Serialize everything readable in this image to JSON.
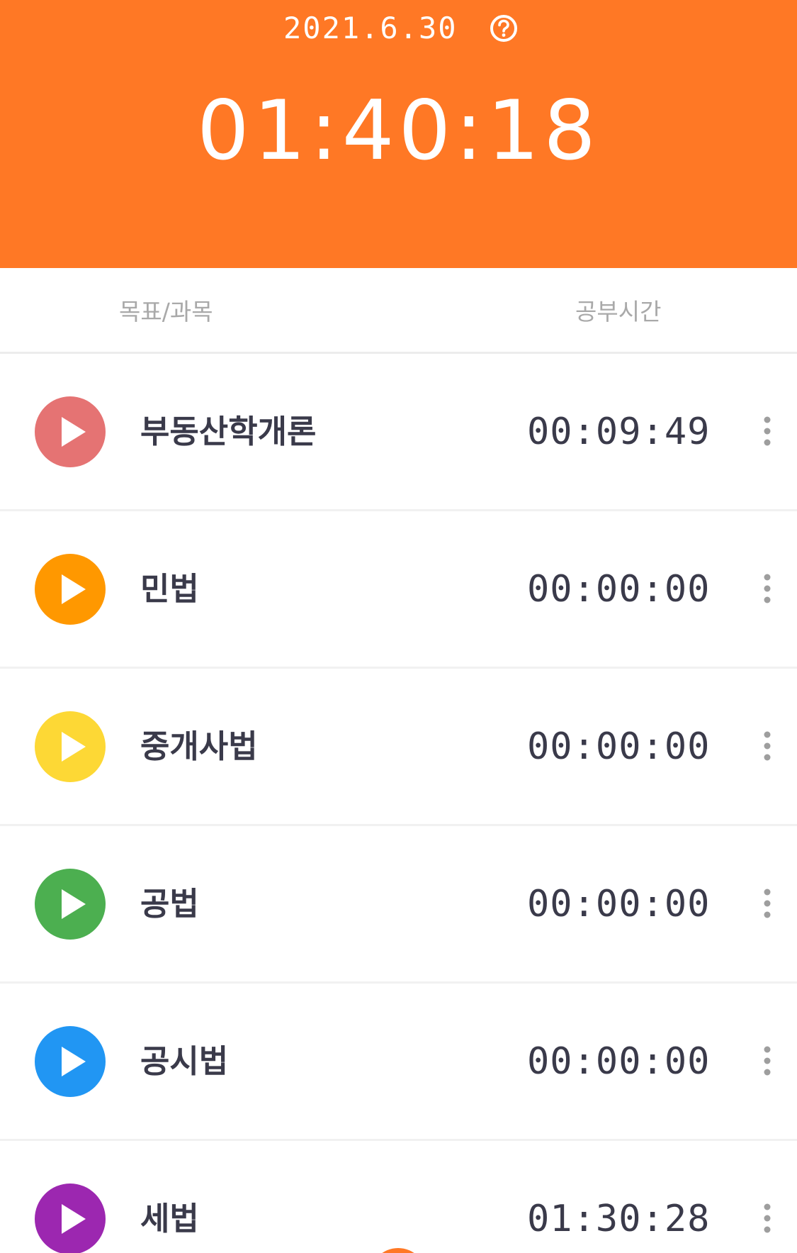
{
  "header": {
    "date": "2021.6.30",
    "help_icon": "question-circle-icon",
    "total_time": "01:40:18",
    "background_color": "#FF7825"
  },
  "columns": {
    "goal_label": "목표/과목",
    "time_label": "공부시간"
  },
  "subjects": [
    {
      "name": "부동산학개론",
      "time": "00:09:49",
      "color": "#E57373"
    },
    {
      "name": "민법",
      "time": "00:00:00",
      "color": "#FF9800"
    },
    {
      "name": "중개사법",
      "time": "00:00:00",
      "color": "#FDD835"
    },
    {
      "name": "공법",
      "time": "00:00:00",
      "color": "#4CAF50"
    },
    {
      "name": "공시법",
      "time": "00:00:00",
      "color": "#2196F3"
    },
    {
      "name": "세법",
      "time": "01:30:28",
      "color": "#9C27B0"
    }
  ],
  "icons": {
    "play": "play-icon",
    "more": "more-vertical-icon"
  }
}
